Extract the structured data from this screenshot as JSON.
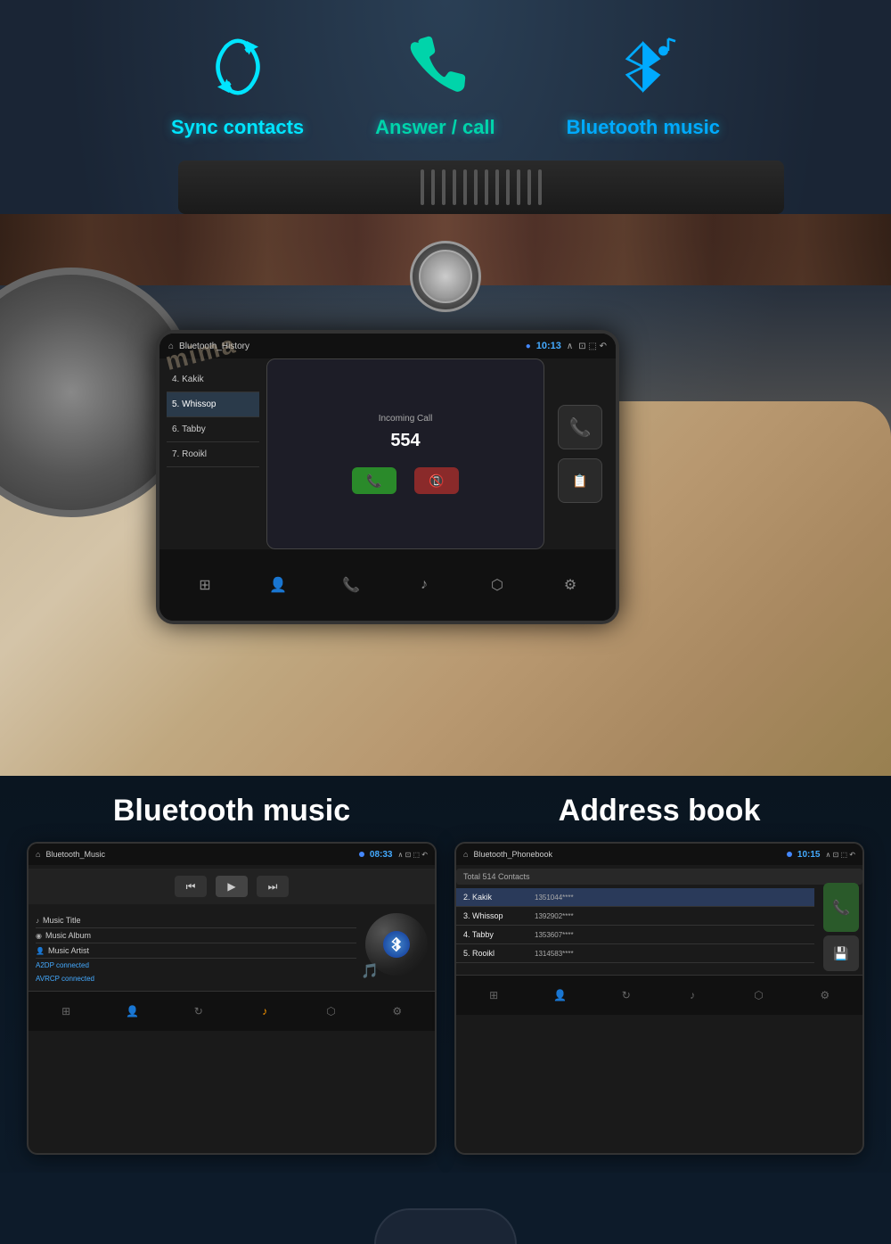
{
  "features": [
    {
      "id": "sync",
      "label": "Sync contacts",
      "color": "#00e5ff",
      "icon": "sync"
    },
    {
      "id": "answer",
      "label": "Answer / call",
      "color": "#00d4aa",
      "icon": "phone"
    },
    {
      "id": "bluetooth",
      "label": "Bluetooth music",
      "color": "#00aaff",
      "icon": "music-note"
    }
  ],
  "car_screen": {
    "title": "Bluetooth_History",
    "time": "10:13",
    "contacts": [
      {
        "num": "4.",
        "name": "Kakik"
      },
      {
        "num": "5.",
        "name": "Whissop"
      },
      {
        "num": "6.",
        "name": "Tabby"
      },
      {
        "num": "7.",
        "name": "Rooikl"
      }
    ],
    "incoming_call": {
      "label": "Incoming Call",
      "number": "554"
    }
  },
  "bottom": {
    "music_panel": {
      "title": "Bluetooth music",
      "screen_title": "Bluetooth_Music",
      "time": "08:33",
      "music_title": "Music Title",
      "music_album": "Music Album",
      "music_artist": "Music Artist",
      "status1": "A2DP connected",
      "status2": "AVRCP connected"
    },
    "phonebook_panel": {
      "title": "Address book",
      "screen_title": "Bluetooth_Phonebook",
      "time": "10:15",
      "total": "Total 514 Contacts",
      "contacts": [
        {
          "num": "2.",
          "name": "Kakik",
          "number": "1351044****"
        },
        {
          "num": "3.",
          "name": "Whissop",
          "number": "1392902****"
        },
        {
          "num": "4.",
          "name": "Tabby",
          "number": "1353607****"
        },
        {
          "num": "5.",
          "name": "Rooikl",
          "number": "1314583****"
        }
      ]
    }
  },
  "nav_icons": [
    "⊞",
    "👤",
    "↻",
    "♪",
    "⬡",
    "⚙"
  ],
  "home_indicator": true
}
